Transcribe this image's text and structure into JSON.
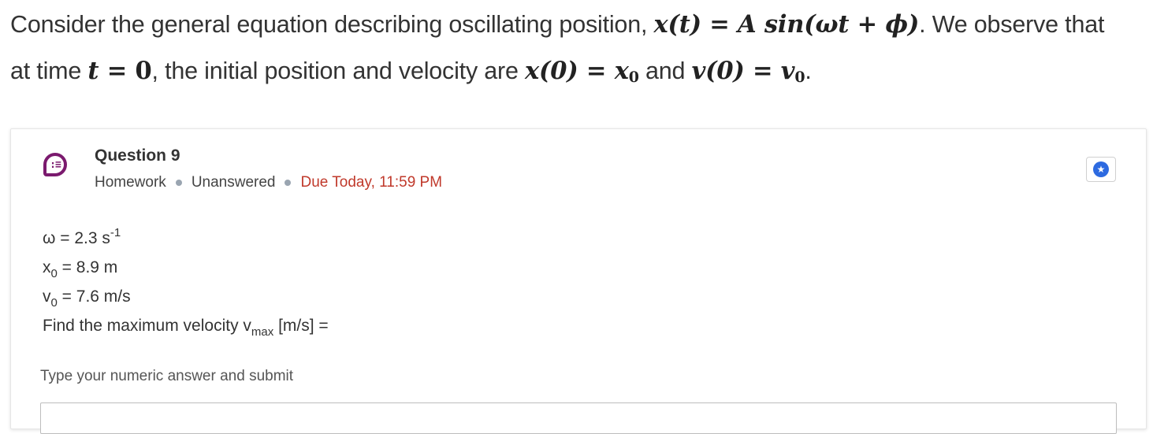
{
  "intro": {
    "line1_text": "Consider the general equation describing oscillating position, ",
    "line1_eq_lhs": "x(t)",
    "line1_eq_eq": " = ",
    "line1_eq_rhs": "A sin(ωt + ϕ)",
    "line1_tail": ". We observe that",
    "line2_text": "at time ",
    "line2_t": "t",
    "line2_eq": " = ",
    "line2_zero": "0",
    "line2_mid": ", the initial position and velocity are ",
    "line2_x0": "x(0)",
    "line2_eq2": " = ",
    "line2_x0v": "x",
    "line2_x0sub": "0",
    "line2_and": " and ",
    "line2_v0": "v(0)",
    "line2_eq3": " = ",
    "line2_v0v": "v",
    "line2_v0sub": "0",
    "line2_end": "."
  },
  "question": {
    "icon": "multi-choice-icon",
    "icon_glyph": ":≡",
    "title": "Question 9",
    "type": "Homework",
    "status": "Unanswered",
    "due": "Due Today, 11:59 PM",
    "star_glyph": "★",
    "omega_label": "ω = 2.3 s",
    "omega_exp": "-1",
    "x0_label": "x",
    "x0_sub": "0",
    "x0_value": " = 8.9 m",
    "v0_label": "v",
    "v0_sub": "0",
    "v0_value": " = 7.6 m/s",
    "prompt_pre": "Find the maximum velocity v",
    "prompt_sub": "max",
    "prompt_post": " [m/s] =",
    "hint": "Type your numeric answer and submit",
    "answer_value": ""
  },
  "colors": {
    "icon_accent": "#7b1a6e",
    "due_red": "#c0392b",
    "star_blue": "#2d6ae0"
  }
}
